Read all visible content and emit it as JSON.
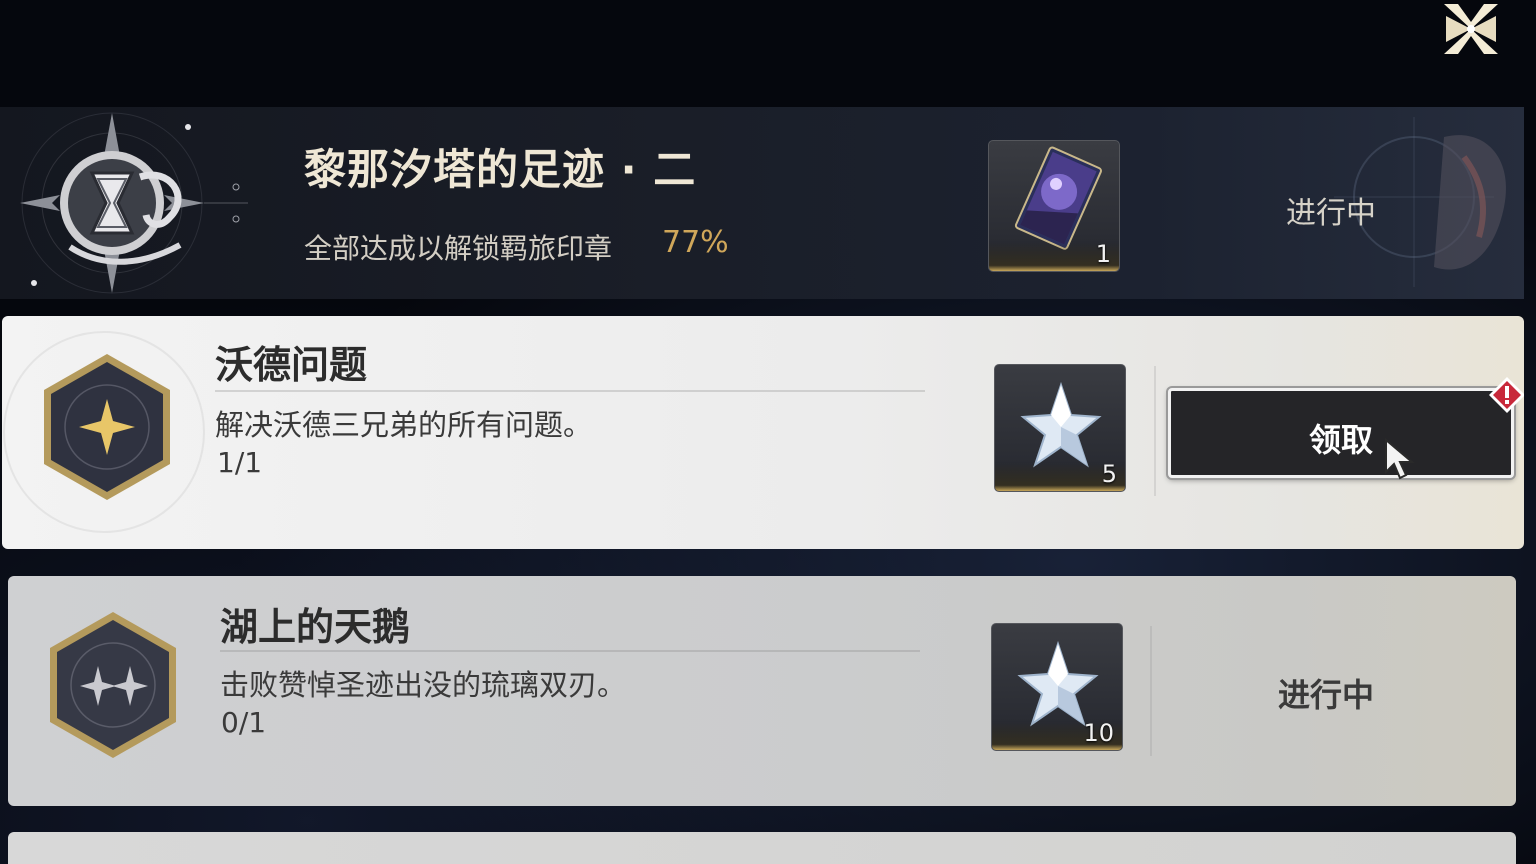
{
  "banner": {
    "title": "黎那汐塔的足迹 · 二",
    "subtitle": "全部达成以解锁羁旅印章",
    "percent": "77%",
    "reward_qty": "1",
    "status": "进行中"
  },
  "quests": [
    {
      "title": "沃德问题",
      "description": "解决沃德三兄弟的所有问题。",
      "progress": "1/1",
      "reward_qty": "5",
      "action_label": "领取"
    },
    {
      "title": "湖上的天鹅",
      "description": "击败赞悼圣迹出没的琉璃双刃。",
      "progress": "0/1",
      "reward_qty": "10",
      "status": "进行中"
    }
  ],
  "colors": {
    "accent_gold": "#d0a75a",
    "alert_red": "#c8283a"
  },
  "icons": {
    "close": "close-x-icon",
    "emblem": "hourglass-emblem-icon",
    "reward_card": "card-reward-icon",
    "reward_star": "crystal-star-icon",
    "alert": "exclamation-diamond-icon"
  }
}
